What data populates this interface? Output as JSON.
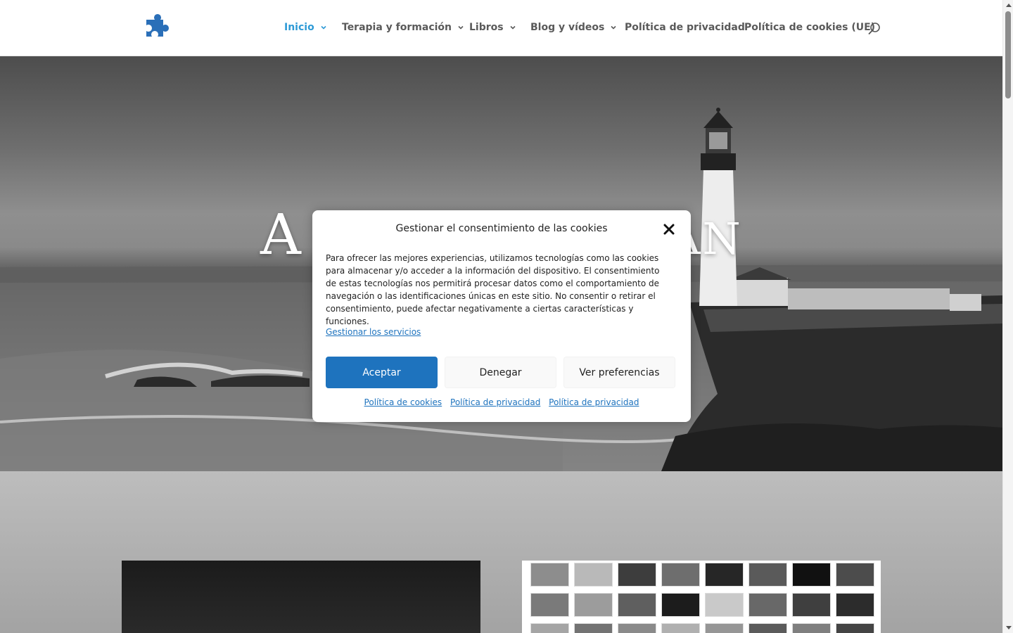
{
  "header": {
    "logo_icon": "puzzle-piece-icon",
    "nav": [
      {
        "label": "Inicio",
        "has_dropdown": true,
        "active": true
      },
      {
        "label": "Terapia y formación",
        "has_dropdown": true,
        "active": false
      },
      {
        "label": "Libros",
        "has_dropdown": true,
        "active": false
      },
      {
        "label": "Blog y vídeos",
        "has_dropdown": true,
        "active": false
      },
      {
        "label": "Política de privacidad",
        "has_dropdown": false,
        "active": false
      },
      {
        "label": "Política de cookies (UE)",
        "has_dropdown": false,
        "active": false
      }
    ],
    "search_icon": "search-icon"
  },
  "hero": {
    "title_left": "A",
    "title_right": "AN"
  },
  "cookie_modal": {
    "title": "Gestionar el consentimiento de las cookies",
    "body": "Para ofrecer las mejores experiencias, utilizamos tecnologías como las cookies para almacenar y/o acceder a la información del dispositivo. El consentimiento de estas tecnologías nos permitirá procesar datos como el comportamiento de navegación o las identificaciones únicas en este sitio. No consentir o retirar el consentimiento, puede afectar negativamente a ciertas características y funciones.",
    "manage_link": "Gestionar los servicios",
    "buttons": {
      "accept": "Aceptar",
      "deny": "Denegar",
      "preferences": "Ver preferencias"
    },
    "links": [
      "Política de cookies",
      "Política de privacidad",
      "Política de privacidad"
    ]
  },
  "colors": {
    "accent": "#2e9ad6",
    "button_primary": "#1e73be",
    "nav_text": "#5a5a5a"
  }
}
